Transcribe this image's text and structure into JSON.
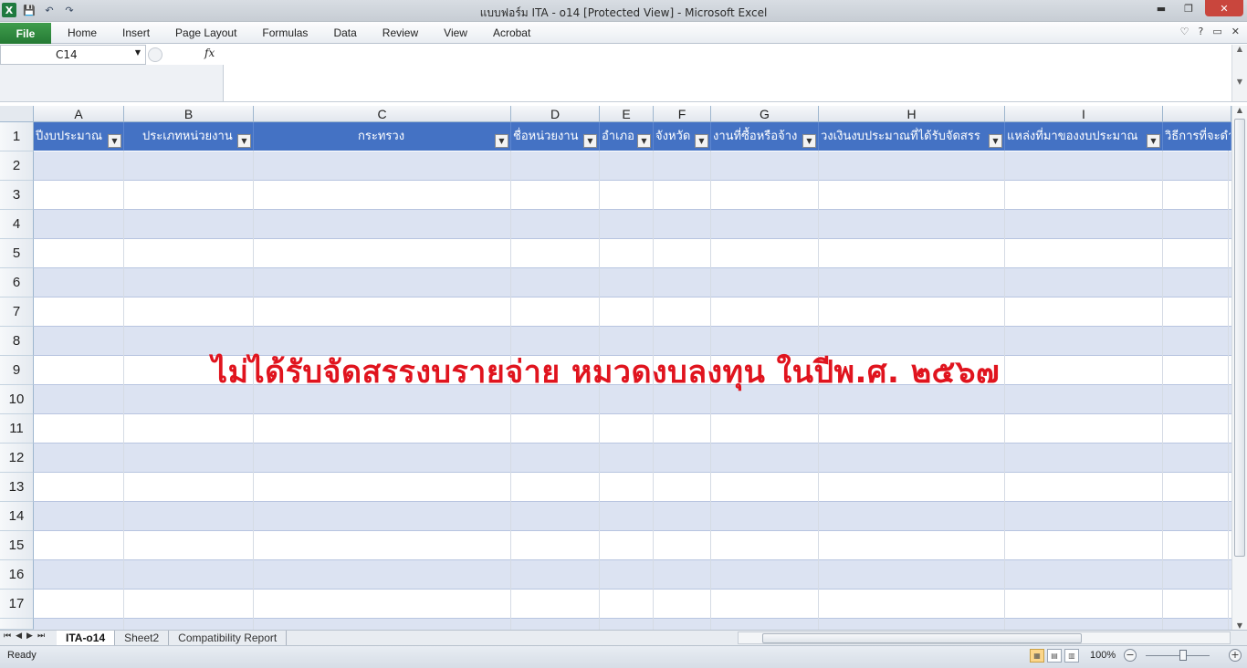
{
  "window": {
    "title": "แบบฟอร์ม ITA - o14  [Protected View]  -  Microsoft Excel",
    "controls": {
      "minimize": "▬",
      "maximize": "❐",
      "close": "✕"
    }
  },
  "quick_access": {
    "logo": "X",
    "save": "💾",
    "undo": "↶",
    "redo": "↷"
  },
  "ribbon": {
    "file": "File",
    "tabs": [
      "Home",
      "Insert",
      "Page Layout",
      "Formulas",
      "Data",
      "Review",
      "View",
      "Acrobat"
    ],
    "right_icons": {
      "min": "♡",
      "help": "?",
      "restore": "▭",
      "close": "✕"
    }
  },
  "formula_bar": {
    "name_box": "C14",
    "fx": "fx",
    "value": ""
  },
  "columns": [
    "A",
    "B",
    "C",
    "D",
    "E",
    "F",
    "G",
    "H",
    "I"
  ],
  "header_row": [
    "ปีงบประมาณ",
    "ประเภทหน่วยงาน",
    "กระทรวง",
    "ชื่อหน่วยงาน",
    "อำเภอ",
    "จังหวัด",
    "งานที่ซื้อหรือจ้าง",
    "วงเงินงบประมาณที่ได้รับจัดสรร",
    "แหล่งที่มาของงบประมาณ",
    "วิธีการที่จะดำ"
  ],
  "row_numbers": [
    "1",
    "2",
    "3",
    "4",
    "5",
    "6",
    "7",
    "8",
    "9",
    "10",
    "11",
    "12",
    "13",
    "14",
    "15",
    "16",
    "17"
  ],
  "overlay_text": "ไม่ได้รับจัดสรรงบรายจ่าย หมวดงบลงทุน ในปีพ.ศ. ๒๕๖๗",
  "sheet_tabs": [
    "ITA-o14",
    "Sheet2",
    "Compatibility Report"
  ],
  "active_tab": "ITA-o14",
  "status": {
    "ready": "Ready",
    "zoom": "100%"
  },
  "colors": {
    "header_fill": "#4472c4",
    "band_fill": "#dce3f2",
    "overlay_text": "#e0141e"
  }
}
